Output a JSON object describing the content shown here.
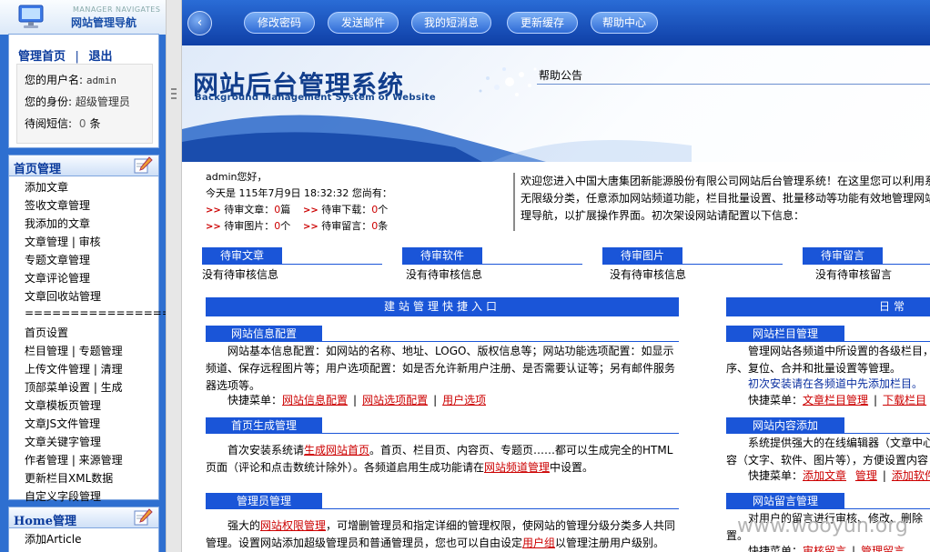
{
  "sidebar": {
    "logo_en": "MANAGER NAVIGATES",
    "logo_cn": "网站管理导航",
    "home_link": "管理首页",
    "logout_link": "退出",
    "sep": "|",
    "username_label": "您的用户名:",
    "username": "admin",
    "role_label": "您的身份:",
    "role": "超级管理员",
    "msg_label": "待阅短信:",
    "msg_count": "0",
    "msg_unit": "条",
    "menu1_title": "首页管理",
    "menu1_items": [
      "添加文章",
      "签收文章管理",
      "我添加的文章",
      "文章管理 | 审核",
      "专题文章管理",
      "文章评论管理",
      "文章回收站管理",
      "====================",
      "首页设置",
      "栏目管理 | 专题管理",
      "上传文件管理 | 清理",
      "顶部菜单设置 | 生成",
      "文章模板页管理",
      "文章JS文件管理",
      "文章关键字管理",
      "作者管理 | 来源管理",
      "更新栏目XML数据",
      "自定义字段管理"
    ],
    "menu2_title": "Home管理",
    "menu2_items": [
      "添加Article"
    ]
  },
  "topnav": {
    "back_icon": "‹",
    "buttons": [
      "修改密码",
      "发送邮件",
      "我的短消息",
      "更新缓存",
      "帮助中心"
    ]
  },
  "banner": {
    "title": "网站后台管理系统",
    "subtitle": "Background Management System of Website",
    "notice": "帮助公告"
  },
  "welcome": {
    "greeting": "admin您好，",
    "today": "今天是 115年7月9日 18:32:32 您尚有：",
    "arrow": ">>",
    "items": [
      {
        "label": "待审文章：",
        "value": "0",
        "unit": "篇"
      },
      {
        "label": "待审下载：",
        "value": "0",
        "unit": "个"
      },
      {
        "label": "待审图片：",
        "value": "0",
        "unit": "个"
      },
      {
        "label": "待审留言：",
        "value": "0",
        "unit": "条"
      }
    ],
    "intro_lines": [
      "欢迎您进入中国大唐集团新能源股份有限公司网站后台管理系统！在这里您可以利用系统提供的",
      "无限级分类，任意添加网站频道功能，栏目批量设置、批量移动等功能有效地管理网站，快速地",
      "理导航，以扩展操作界面。初次架设网站请配置以下信息："
    ]
  },
  "pending": [
    {
      "label": "待审文章",
      "value": "没有待审核信息"
    },
    {
      "label": "待审软件",
      "value": "没有待审核信息"
    },
    {
      "label": "待审图片",
      "value": "没有待审核信息"
    },
    {
      "label": "待审留言",
      "value": "没有待审核留言"
    }
  ],
  "quick": {
    "title": "建站管理快捷入口",
    "site_config": {
      "title": "网站信息配置",
      "text": "网站基本信息配置：如网站的名称、地址、LOGO、版权信息等；网站功能选项配置：如显示频道、保存远程图片等；用户选项配置：如是否允许新用户注册、是否需要认证等；另有邮件服务器选项等。",
      "menu_label": "快捷菜单：",
      "links": [
        "网站信息配置",
        "网站选项配置",
        "用户选项"
      ]
    },
    "home_gen": {
      "title": "首页生成管理",
      "pre": "首次安装系统请",
      "link1": "生成网站首页",
      "mid": "。首页、栏目页、内容页、专题页……都可以生成完全的HTML页面（评论和点击数统计除外）。各频道启用生成功能请在",
      "link2": "网站频道管理",
      "post": "中设置。"
    },
    "admin": {
      "title": "管理员管理",
      "pre": "强大的",
      "link1": "网站权限管理",
      "mid": "，可增删管理员和指定详细的管理权限，使网站的管理分级分类多人共同管理。设置网站添加超级管理员和普通管理员，您也可以自由设定",
      "link2": "用户组",
      "post": "以管理注册用户级别。"
    }
  },
  "daily": {
    "title": "日常",
    "column": {
      "title": "网站栏目管理",
      "text": "管理网站各频道中所设置的各级栏目，序、复位、合并和批量设置等管理。",
      "hint": "初次安装请在各频道中先添加栏目。",
      "menu_label": "快捷菜单：",
      "links": [
        "文章栏目管理",
        "下载栏目"
      ]
    },
    "content": {
      "title": "网站内容添加",
      "text": "系统提供强大的在线编辑器（文章中心容（文字、软件、图片等），方便设置内容",
      "menu_label": "快捷菜单：",
      "links": [
        "添加文章",
        "管理",
        "添加软件"
      ]
    },
    "guestbook": {
      "title": "网站留言管理",
      "text": "对用户的留言进行审核、修改、删除置。",
      "menu_label": "快捷菜单：",
      "links": [
        "审核留言",
        "管理留言"
      ]
    }
  },
  "watermark": "www.wooyun.org"
}
